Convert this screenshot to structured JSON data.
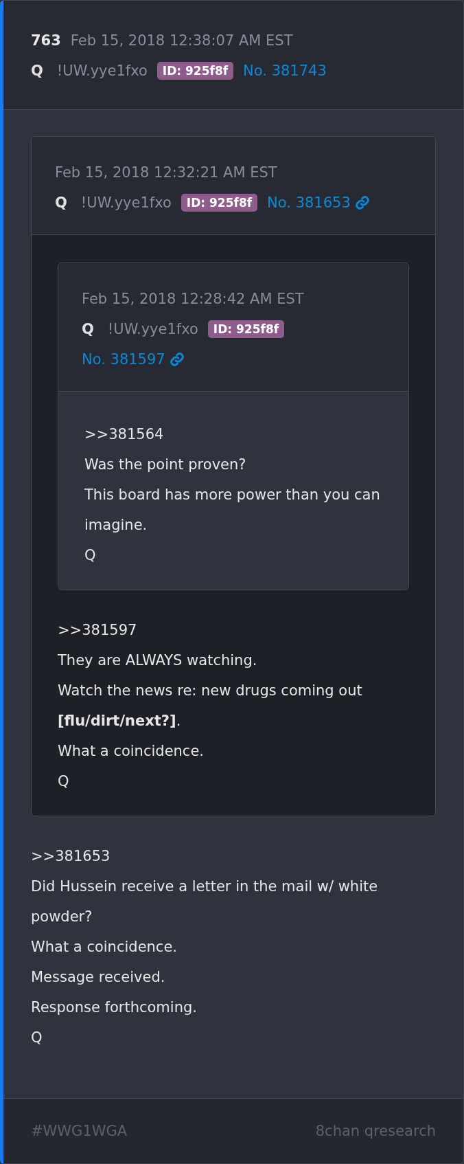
{
  "post": {
    "index": "763",
    "date": "Feb 15, 2018 12:38:07 AM EST",
    "name": "Q",
    "trip": "!UW.yye1fxo",
    "id": "ID: 925f8f",
    "number": "No. 381743",
    "link_icon": false,
    "quote": {
      "date": "Feb 15, 2018 12:32:21 AM EST",
      "name": "Q",
      "trip": "!UW.yye1fxo",
      "id": "ID: 925f8f",
      "number": "No. 381653",
      "link_icon": true,
      "quote": {
        "date": "Feb 15, 2018 12:28:42 AM EST",
        "name": "Q",
        "trip": "!UW.yye1fxo",
        "id": "ID: 925f8f",
        "number": "No. 381597",
        "link_icon": true,
        "lines": [
          ">>381564",
          "Was the point proven?",
          "This board has more power than you can imagine.",
          "Q"
        ]
      },
      "lines": [
        ">>381597",
        "They are ALWAYS watching.",
        "Watch the news re: new drugs coming out **[flu/dirt/next?]**.",
        "What a coincidence.",
        "Q"
      ]
    },
    "lines": [
      ">>381653",
      "Did Hussein receive a letter in the mail w/ white powder?",
      "What a coincidence.",
      "Message received.",
      "Response forthcoming.",
      "Q"
    ]
  },
  "footer": {
    "hashtag": "#WWG1WGA",
    "source": "8chan qresearch"
  }
}
